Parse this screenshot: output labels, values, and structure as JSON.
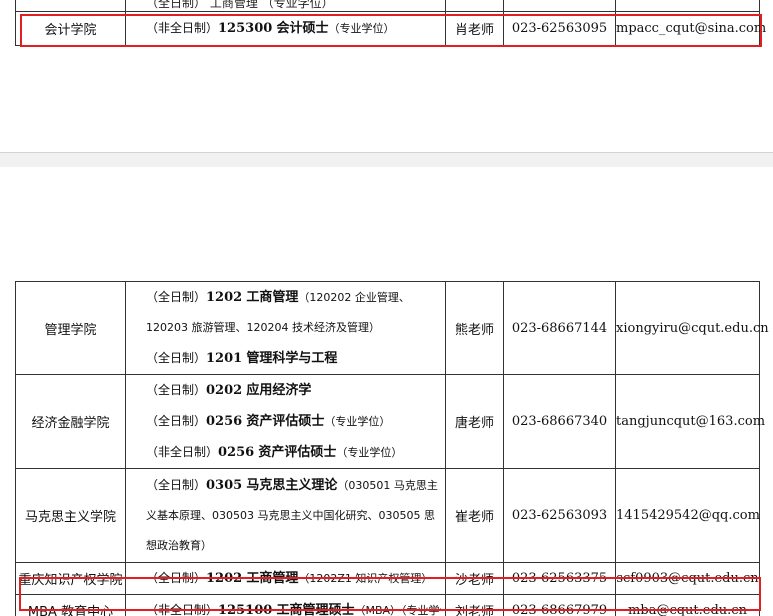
{
  "top_table": {
    "partial_line": "（全日制）  工商管理  （专业学位）",
    "row": {
      "college": "会计学院",
      "mode": "（非全日制）",
      "code": "125300",
      "program": "会计硕士",
      "note": "（专业学位）",
      "teacher": "肖老师",
      "phone": "023-62563095",
      "email": "mpacc_cqut@sina.com"
    }
  },
  "bottom_table": {
    "rows": [
      {
        "college": "管理学院",
        "lines": [
          {
            "mode": "（全日制）",
            "code": "1202",
            "program": "工商管理",
            "note": "（120202 企业管理、120203 旅游管理、120204 技术经济及管理）"
          },
          {
            "mode": "（全日制）",
            "code": "1201",
            "program": "管理科学与工程",
            "note": ""
          }
        ],
        "teacher": "熊老师",
        "phone": "023-68667144",
        "email": "xiongyiru@cqut.edu.cn"
      },
      {
        "college": "经济金融学院",
        "lines": [
          {
            "mode": "（全日制）",
            "code": "0202",
            "program": "应用经济学",
            "note": ""
          },
          {
            "mode": "（全日制）",
            "code": "0256",
            "program": "资产评估硕士",
            "note": "（专业学位）"
          },
          {
            "mode": "（非全日制）",
            "code": "0256",
            "program": "资产评估硕士",
            "note": "（专业学位）"
          }
        ],
        "teacher": "唐老师",
        "phone": "023-68667340",
        "email": "tangjuncqut@163.com"
      },
      {
        "college": "马克思主义学院",
        "lines": [
          {
            "mode": "（全日制）",
            "code": "0305",
            "program": "马克思主义理论",
            "note": "（030501 马克思主义基本原理、030503 马克思主义中国化研究、030505 思想政治教育）"
          }
        ],
        "teacher": "崔老师",
        "phone": "023-62563093",
        "email": "1415429542@qq.com"
      },
      {
        "college": "重庆知识产权学院",
        "lines": [
          {
            "mode": "（全日制）",
            "code": "1202",
            "program": "工商管理",
            "note": "（1202Z1 知识产权管理）"
          }
        ],
        "teacher": "沙老师",
        "phone": "023-62563375",
        "email": "scf0903@cqut.edu.cn"
      },
      {
        "college": "MBA 教育中心",
        "lines": [
          {
            "mode": "（非全日制）",
            "code": "125100",
            "program": "工商管理硕士",
            "note": "（MBA）（专业学位）"
          }
        ],
        "teacher": "刘老师",
        "phone": "023-68667979",
        "email": "mba@cqut.edu.cn"
      }
    ]
  },
  "colors": {
    "highlight": "#e02020",
    "border": "#333333"
  }
}
